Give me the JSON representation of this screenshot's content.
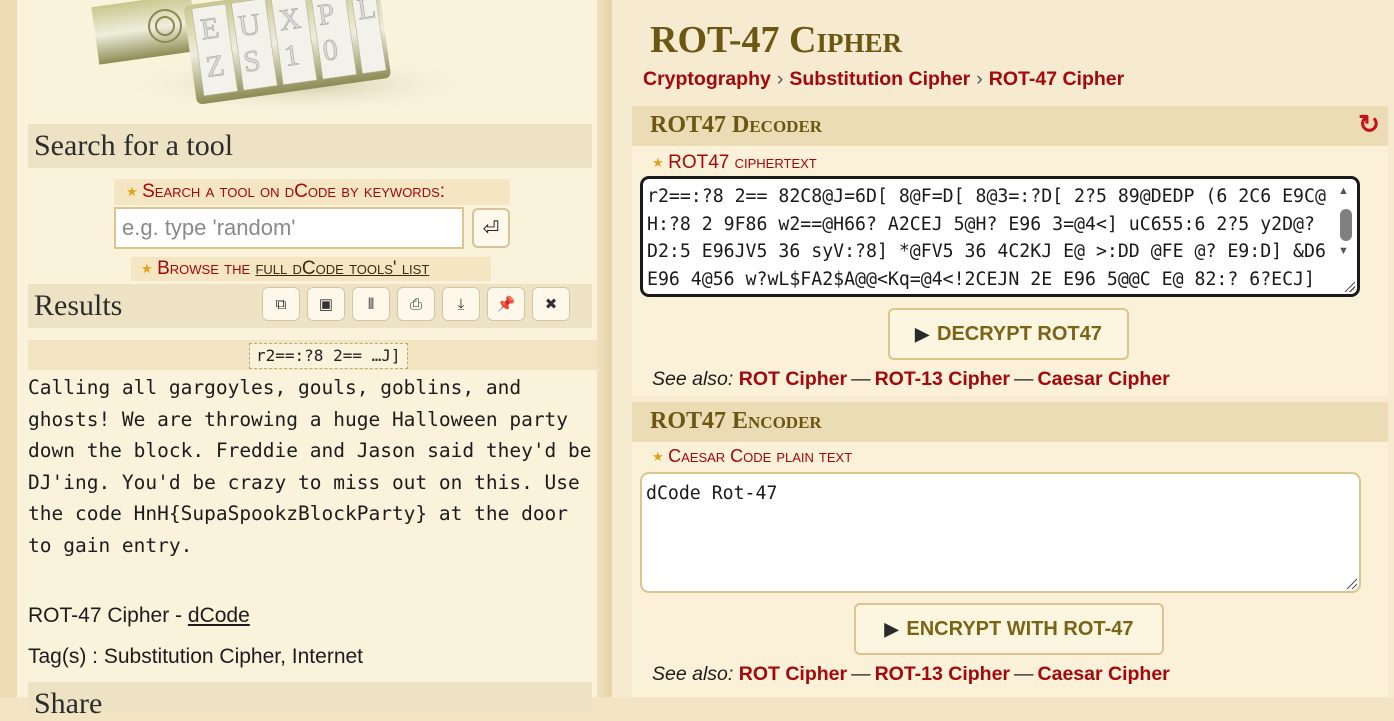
{
  "left": {
    "search": {
      "title": "Search for a tool",
      "keywords_label": "Search a tool on dCode by keywords:",
      "placeholder": "e.g. type 'random'",
      "browse_prefix": "Browse the ",
      "browse_link": "full dCode tools' list"
    },
    "results": {
      "title": "Results",
      "toolbar": [
        "copy-icon",
        "save-icon",
        "columns-icon",
        "print-icon",
        "download-icon",
        "pin-icon",
        "close-icon"
      ],
      "result_tag": "r2==:?8 2== …J]",
      "result_text": "Calling all gargoyles, gouls, goblins, and ghosts! We are throwing a huge Halloween party down the block. Freddie and Jason said they'd be DJ'ing. You'd be crazy to miss out on this. Use the code HnH{SupaSpookzBlockParty} at the door to gain entry.",
      "cite_prefix": "ROT-47 Cipher - ",
      "cite_link": "dCode",
      "tags": "Tag(s) : Substitution Cipher, Internet"
    },
    "share": {
      "title": "Share"
    }
  },
  "right": {
    "title": "ROT-47 Cipher",
    "breadcrumb": [
      "Cryptography",
      "Substitution Cipher",
      "ROT-47 Cipher"
    ],
    "decoder": {
      "title": "ROT47 Decoder",
      "field_label": "ROT47 ciphertext",
      "ciphertext": "r2==:?8 2== 82C8@J=6D[ 8@F=D[ 8@3=:?D[ 2?5 89@DEDP (6 2C6 E9C@H:?8 2 9F86 w2==@H66? A2CEJ 5@H? E96 3=@4<] uC655:6 2?5 y2D@? D2:5 E96JV5 36 syV:?8] *@FV5 36 4C2KJ E@ >:DD @FE @? E9:D] &D6 E96 4@56 w?wL$FA2$A@@<Kq=@4<!2CEJN 2E E96 5@@C E@ 82:? 6?ECJ]",
      "button": "DECRYPT ROT47",
      "see_also_label": "See also:",
      "see_also": [
        "ROT Cipher",
        "ROT-13 Cipher",
        "Caesar Cipher"
      ]
    },
    "encoder": {
      "title": "ROT47 Encoder",
      "field_label": "Caesar Code plain text",
      "plaintext": "dCode Rot-47",
      "button": "ENCRYPT WITH ROT-47",
      "see_also_label": "See also:",
      "see_also": [
        "ROT Cipher",
        "ROT-13 Cipher",
        "Caesar Cipher"
      ]
    }
  },
  "colors": {
    "accent_red": "#a3080c",
    "title_olive": "#6b5712",
    "panel_bg": "#fbf1d9",
    "header_bg": "#ecdcb6"
  }
}
